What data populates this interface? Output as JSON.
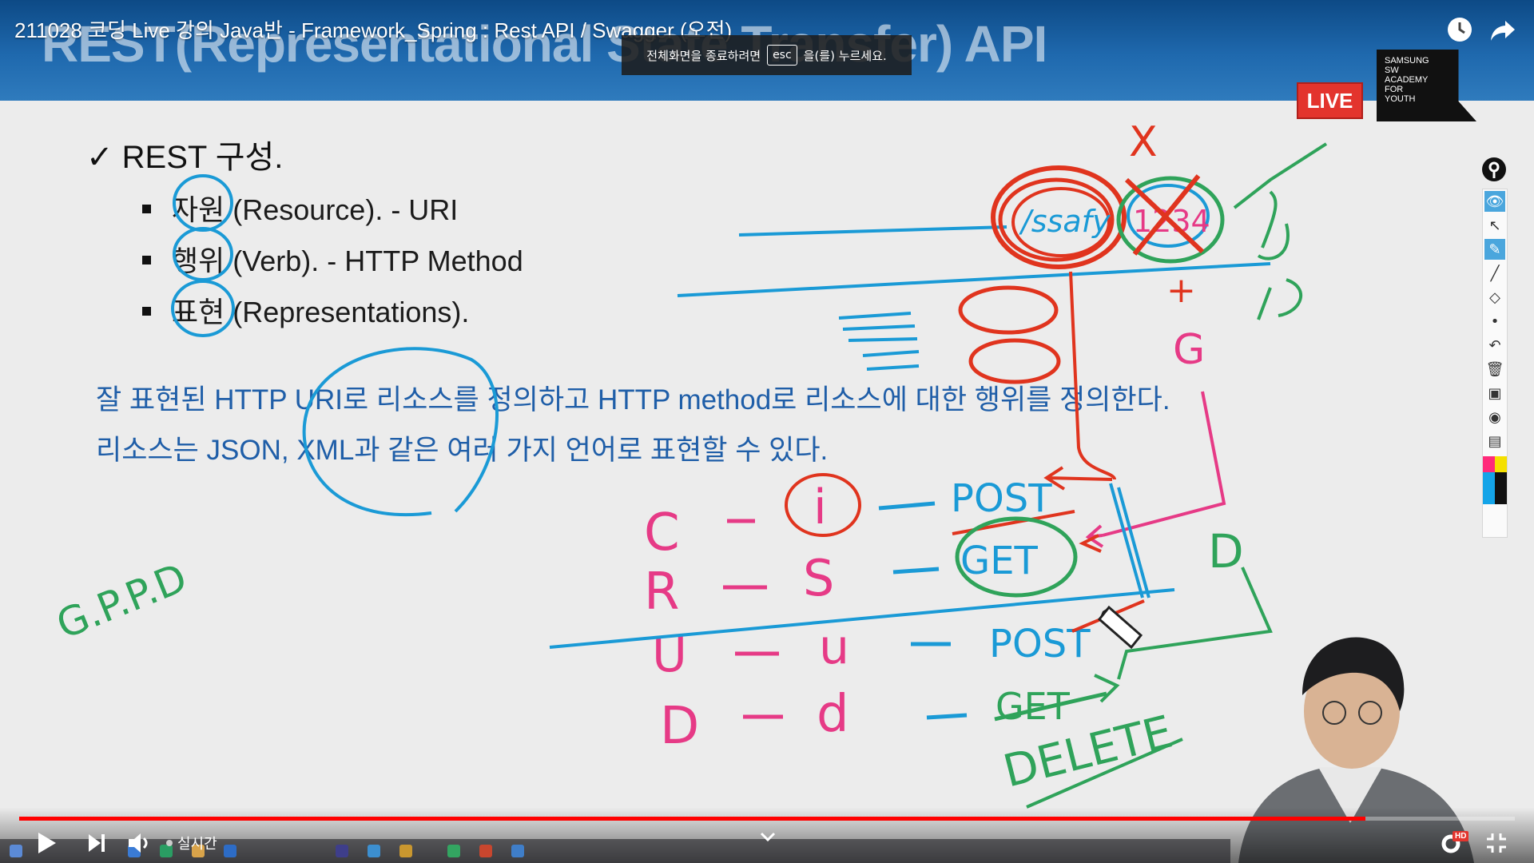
{
  "video": {
    "title": "211028 코딩 Live 강의 Java반 - Framework_Spring : Rest API / Swagger (오전)"
  },
  "slide": {
    "title_ghost": "REST(Representational State Transfer) API",
    "heading": "REST 구성.",
    "bullets": [
      {
        "term": "자원",
        "rest": "(Resource). - URI"
      },
      {
        "term": "행위",
        "rest": "(Verb). - HTTP Method"
      },
      {
        "term": "표현",
        "rest": "(Representations)."
      }
    ],
    "desc_lines": [
      "잘 표현된 HTTP URI로 리소스를 정의하고 HTTP method로 리소스에 대한 행위를 정의한다.",
      "리소스는 JSON, XML과 같은 여러 가지 언어로 표현할 수 있다."
    ]
  },
  "fullscreen_toast": {
    "before": "전체화면을 종료하려면",
    "key": "esc",
    "after": "을(를) 누르세요."
  },
  "live_badge": "LIVE",
  "academy_logo": [
    "SAMSUNG",
    "SW",
    "ACADEMY",
    "FOR",
    "YOUTH"
  ],
  "handwriting": {
    "crud_letters": [
      "C",
      "R",
      "U",
      "D"
    ],
    "crud_lower": [
      "i",
      "S",
      "u",
      "d"
    ],
    "methods": [
      "POST",
      "GET",
      "POST",
      "GET",
      "DELETE"
    ],
    "gppd": "G.P.P.D",
    "url_parts": [
      "/ssafy",
      "1234"
    ],
    "markers": [
      "X",
      "+",
      "G",
      "D"
    ]
  },
  "player": {
    "live_text": "실시간",
    "progress": 0.9,
    "hd_badge": "HD"
  },
  "colors": {
    "header_blue": "#1f69ae",
    "desc_blue": "#1f5ea8",
    "ink_red": "#e0341e",
    "ink_pink": "#e63a86",
    "ink_blue": "#1a9ad6",
    "ink_green": "#2fa35a",
    "live_red": "#e3342d",
    "progress_red": "#ff0000"
  }
}
